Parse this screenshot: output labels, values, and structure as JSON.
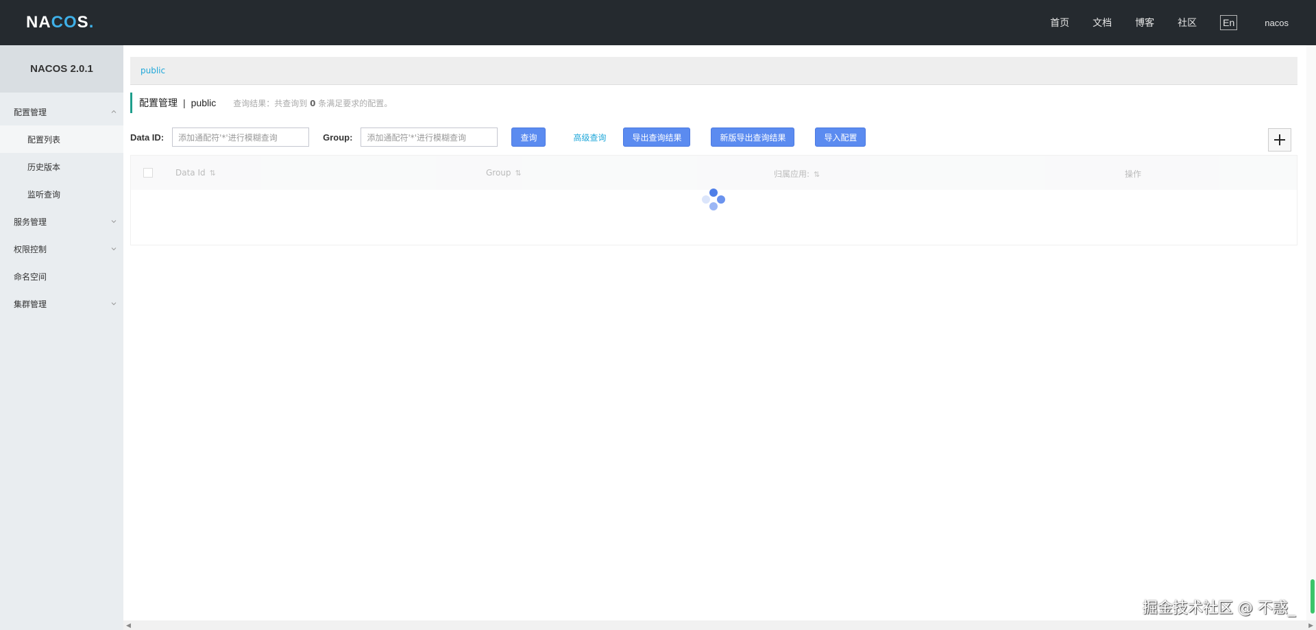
{
  "header": {
    "logo": {
      "part1": "NA",
      "part2": "CO",
      "part3": "S",
      "dot": "."
    },
    "nav": [
      "首页",
      "文档",
      "博客",
      "社区"
    ],
    "lang": "En",
    "user": "nacos"
  },
  "sidebar": {
    "title": "NACOS 2.0.1",
    "menu": {
      "config": {
        "label": "配置管理"
      },
      "config_list": {
        "label": "配置列表"
      },
      "history": {
        "label": "历史版本"
      },
      "listen": {
        "label": "监听查询"
      },
      "service": {
        "label": "服务管理"
      },
      "auth": {
        "label": "权限控制"
      },
      "namespace": {
        "label": "命名空间"
      },
      "cluster": {
        "label": "集群管理"
      }
    }
  },
  "main": {
    "namespace_tab": "public",
    "title": "配置管理",
    "title_sep": "|",
    "title_ns": "public",
    "query_result": {
      "prefix": "查询结果：共查询到",
      "count": "0",
      "suffix": "条满足要求的配置。"
    },
    "search": {
      "data_id_label": "Data ID:",
      "data_id_placeholder": "添加通配符'*'进行模糊查询",
      "group_label": "Group:",
      "group_placeholder": "添加通配符'*'进行模糊查询",
      "query_btn": "查询",
      "advanced_btn": "高级查询",
      "export_btn": "导出查询结果",
      "export_new_btn": "新版导出查询结果",
      "import_btn": "导入配置"
    },
    "table": {
      "columns": [
        "Data Id",
        "Group",
        "归属应用:",
        "操作"
      ]
    }
  },
  "watermark": "掘金技术社区 @ 不惑_",
  "colors": {
    "header_bg": "#252a2f",
    "sidebar_bg": "#e9edf0",
    "primary": "#5b8bf0",
    "link": "#1fa7d9",
    "accent": "#1e9e8c"
  }
}
